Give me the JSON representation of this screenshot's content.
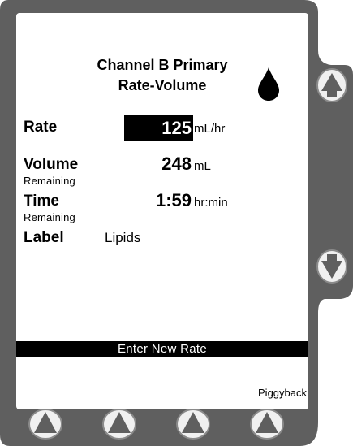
{
  "screen": {
    "title_line1": "Channel B Primary",
    "title_line2": "Rate-Volume",
    "drop_icon": "drop-icon"
  },
  "fields": {
    "rate_label": "Rate",
    "rate_value": "125",
    "rate_unit": "mL/hr",
    "volume_label": "Volume",
    "volume_sublabel": "Remaining",
    "volume_value": "248",
    "volume_unit": "mL",
    "time_label": "Time",
    "time_sublabel": "Remaining",
    "time_value": "1:59",
    "time_unit": "hr:min",
    "label_label": "Label",
    "label_value": "Lipids"
  },
  "prompt": "Enter New Rate",
  "softkeys": {
    "key4_label": "Piggyback"
  },
  "colors": {
    "bezel": "#5f5f5f",
    "bezel_light": "#8a8a8a",
    "key_fill": "#f0f0f0",
    "screen": "#ffffff",
    "highlight": "#000000"
  }
}
